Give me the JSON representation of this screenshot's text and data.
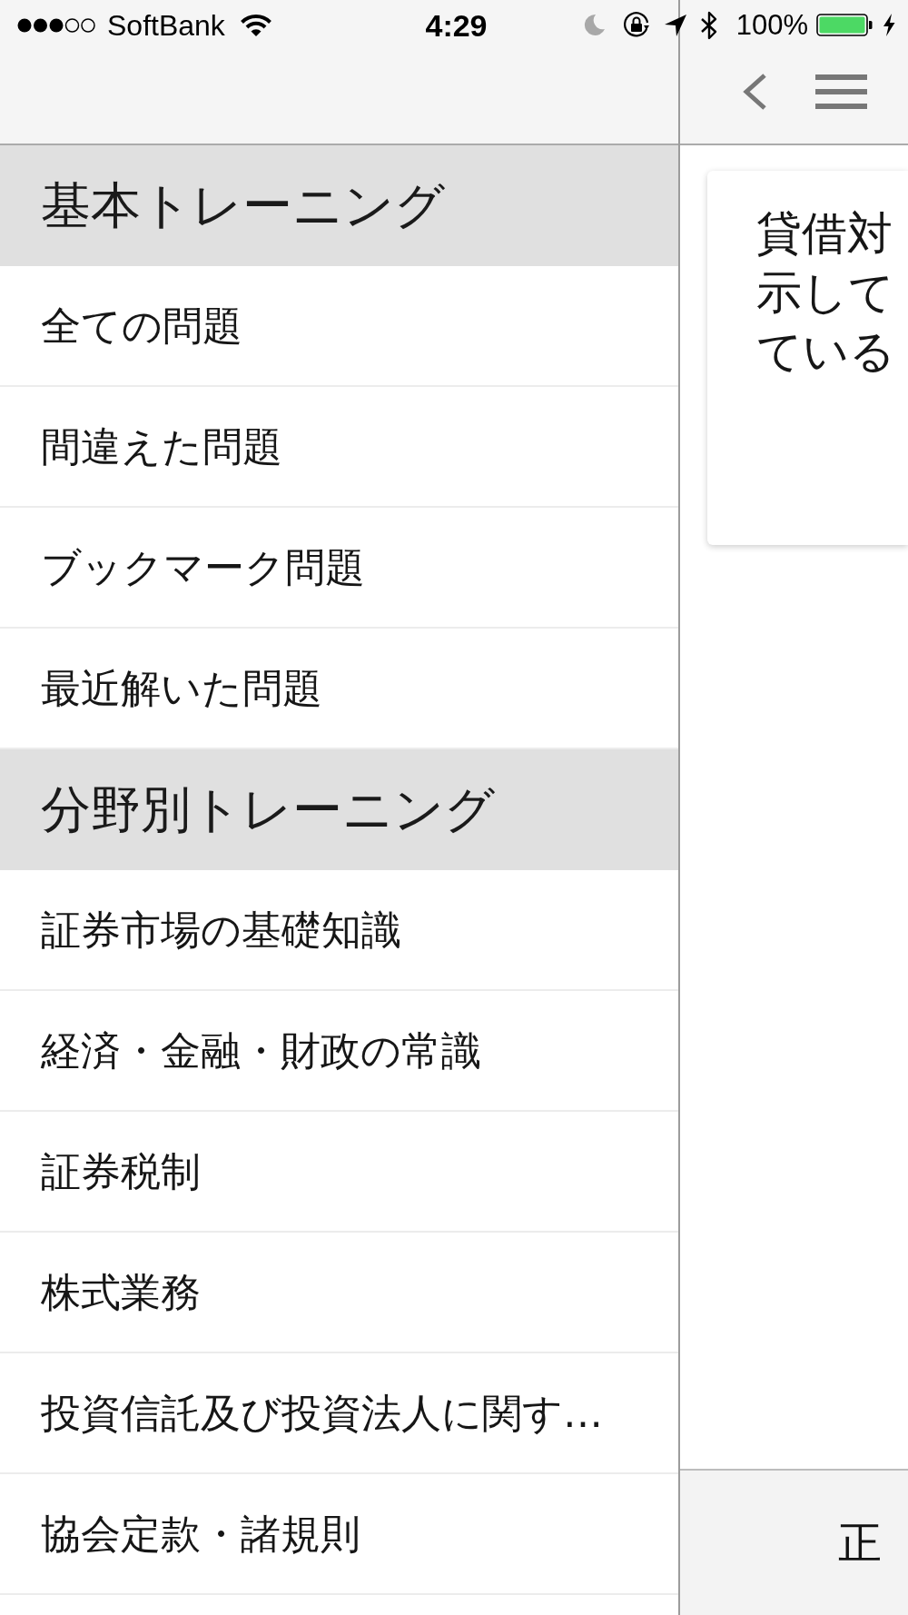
{
  "status_bar": {
    "carrier": "SoftBank",
    "time": "4:29",
    "battery_percent": "100%"
  },
  "drawer": {
    "sections": [
      {
        "title": "基本トレーニング",
        "items": [
          "全ての問題",
          "間違えた問題",
          "ブックマーク問題",
          "最近解いた問題"
        ]
      },
      {
        "title": "分野別トレーニング",
        "items": [
          "証券市場の基礎知識",
          "経済・金融・財政の常識",
          "証券税制",
          "株式業務",
          "投資信託及び投資法人に関す…",
          "協会定款・諸規則"
        ]
      }
    ]
  },
  "question_card": {
    "lines": [
      "貸借対",
      "示して",
      "ている"
    ]
  },
  "answer_buttons": [
    "正"
  ]
}
